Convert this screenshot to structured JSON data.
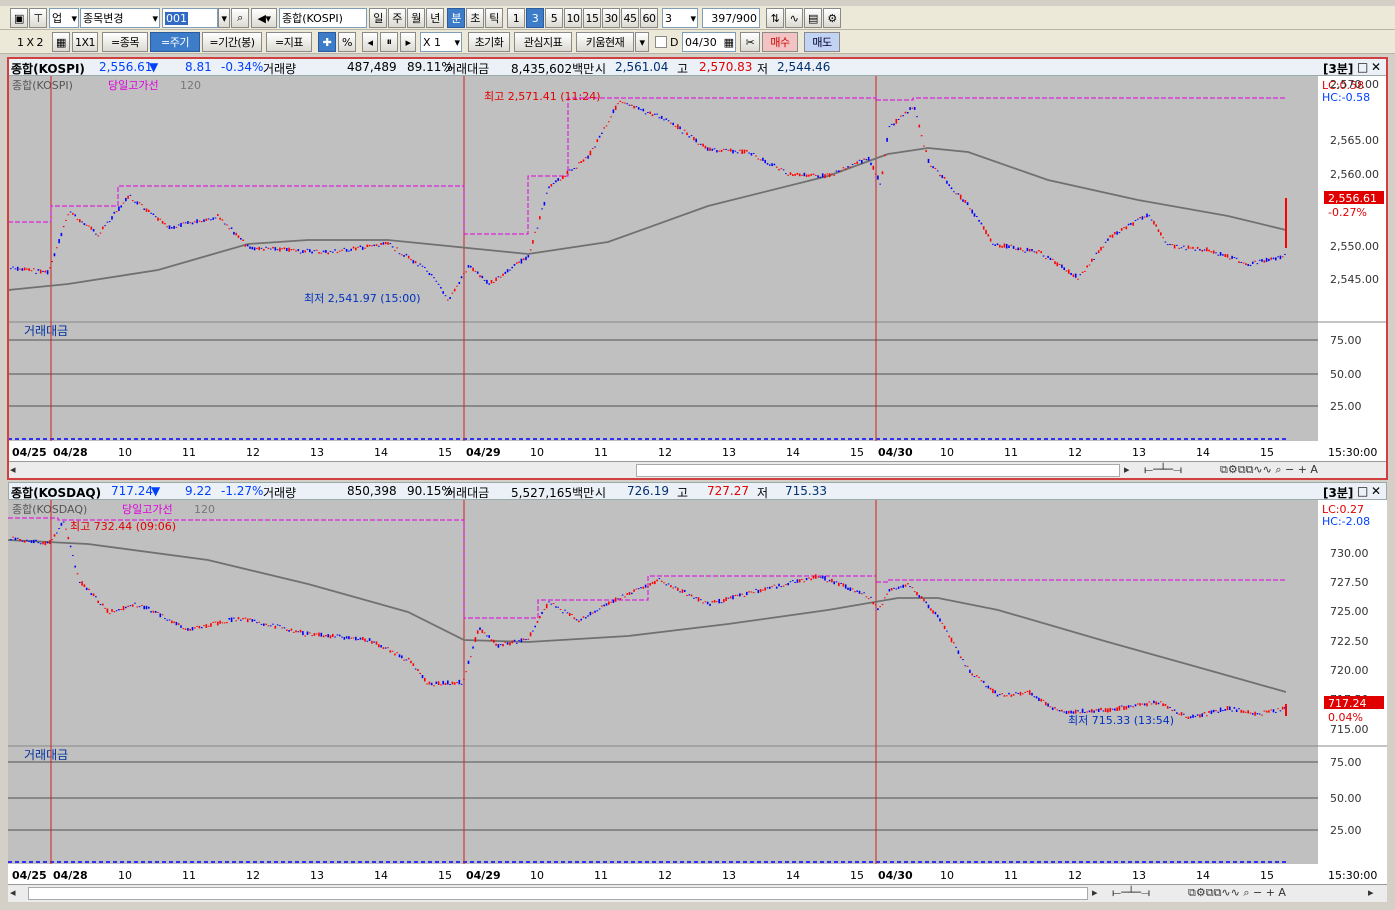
{
  "toolbar1": {
    "biz_label": "업",
    "type_label": "종목변경",
    "code_value": "001",
    "index_name": "종합(KOSPI)",
    "period_buttons": [
      "일",
      "주",
      "월",
      "년",
      "분",
      "초",
      "틱"
    ],
    "minute_buttons": [
      "1",
      "3",
      "5",
      "10",
      "15",
      "30",
      "45",
      "60"
    ],
    "unit_value": "3",
    "count_value": "397",
    "count_max": "/900"
  },
  "toolbar2": {
    "layout_label": "1 X 2",
    "one_label": "1X1",
    "stock_label": "=종목",
    "period_label": "=주기",
    "range_label": "=기간(봉)",
    "indicator_label": "=지표",
    "percent_label": "%",
    "mult_label": "X 1",
    "reset_label": "초기화",
    "interest_label": "관심지표",
    "kiwoom_label": "키움현재",
    "d_label": "D",
    "date_value": "04/30",
    "buy_label": "매수",
    "sell_label": "매도"
  },
  "kospi": {
    "name": "종합(KOSPI)",
    "price": "2,556.61",
    "arrow": "▼",
    "change": "8.81",
    "pct": "-0.34%",
    "vol_label": "거래량",
    "vol": "487,489",
    "vol_pct": "89.11%",
    "amt_label": "거래대금",
    "amt": "8,435,602백만",
    "open_label": "시",
    "open": "2,561.04",
    "high_label": "고",
    "high": "2,570.83",
    "low_label": "저",
    "low": "2,544.46",
    "period_tag": "[3분]",
    "legend_main": "종합(KOSPI)",
    "legend_line": "당일고가선",
    "legend_ma": "120",
    "lc": "LC:0.58",
    "hc": "HC:-0.58",
    "price_tag": "2,556.61",
    "pct_tag": "-0.27%",
    "hi_note": "최고 2,571.41 (11:24)",
    "lo_note": "최저 2,541.97 (15:00)",
    "sub_title": "거래대금",
    "y_ticks": [
      "2,570.00",
      "2,565.00",
      "2,560.00",
      "2,550.00",
      "2,545.00"
    ],
    "sub_ticks": [
      "75.00",
      "50.00",
      "25.00"
    ],
    "x_labels": [
      "04/25",
      "04/28",
      "10",
      "11",
      "12",
      "13",
      "14",
      "15",
      "04/29",
      "10",
      "11",
      "12",
      "13",
      "14",
      "15",
      "04/30",
      "10",
      "11",
      "12",
      "13",
      "14",
      "15"
    ],
    "time_label": "15:30:00"
  },
  "kosdaq": {
    "name": "종합(KOSDAQ)",
    "price": "717.24",
    "arrow": "▼",
    "change": "9.22",
    "pct": "-1.27%",
    "vol_label": "거래량",
    "vol": "850,398",
    "vol_pct": "90.15%",
    "amt_label": "거래대금",
    "amt": "5,527,165백만",
    "open_label": "시",
    "open": "726.19",
    "high_label": "고",
    "high": "727.27",
    "low_label": "저",
    "low": "715.33",
    "period_tag": "[3분]",
    "legend_main": "종합(KOSDAQ)",
    "legend_line": "당일고가선",
    "legend_ma": "120",
    "lc": "LC:0.27",
    "hc": "HC:-2.08",
    "price_tag": "717.24",
    "pct_tag": "0.04%",
    "hi_note": "최고 732.44 (09:06)",
    "lo_note": "최저 715.33 (13:54)",
    "sub_title": "거래대금",
    "y_ticks": [
      "730.00",
      "727.50",
      "725.00",
      "722.50",
      "720.00",
      "717.50",
      "715.00"
    ],
    "sub_ticks": [
      "75.00",
      "50.00",
      "25.00"
    ],
    "x_labels": [
      "04/25",
      "04/28",
      "10",
      "11",
      "12",
      "13",
      "14",
      "15",
      "04/29",
      "10",
      "11",
      "12",
      "13",
      "14",
      "15",
      "04/30",
      "10",
      "11",
      "12",
      "13",
      "14",
      "15"
    ],
    "time_label": "15:30:00"
  },
  "colors": {
    "up": "#ff0000",
    "down": "#0000ff",
    "ma": "#707070",
    "highline": "#e000e0",
    "divider": "#d02020"
  }
}
